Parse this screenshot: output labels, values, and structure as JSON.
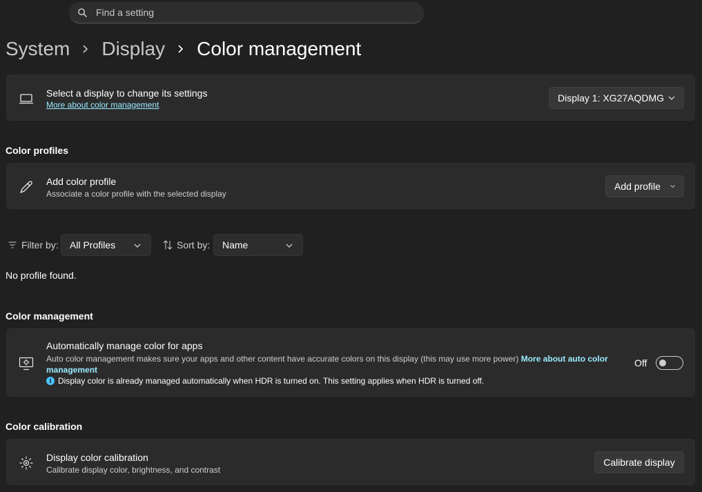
{
  "search": {
    "placeholder": "Find a setting"
  },
  "breadcrumb": {
    "items": [
      "System",
      "Display"
    ],
    "current": "Color management"
  },
  "display_select": {
    "title": "Select a display to change its settings",
    "link": "More about color management",
    "dropdown_value": "Display 1: XG27AQDMG"
  },
  "color_profiles": {
    "heading": "Color profiles",
    "add_title": "Add color profile",
    "add_sub": "Associate a color profile with the selected display",
    "add_button": "Add profile"
  },
  "filters": {
    "filter_label": "Filter by:",
    "filter_value": "All Profiles",
    "sort_label": "Sort by:",
    "sort_value": "Name",
    "empty_message": "No profile found."
  },
  "color_management": {
    "heading": "Color management",
    "auto_title": "Automatically manage color for apps",
    "auto_sub": "Auto color management makes sure your apps and other content have accurate colors on this display (this may use more power)",
    "auto_link": "More about auto color management",
    "info_icon": "i",
    "info_text": "Display color is already managed automatically when HDR is turned on. This setting applies when HDR is turned off.",
    "toggle_state": "Off"
  },
  "color_calibration": {
    "heading": "Color calibration",
    "title": "Display color calibration",
    "sub": "Calibrate display color, brightness, and contrast",
    "button": "Calibrate display"
  },
  "colors": {
    "background": "#202020",
    "card": "#2b2b2b",
    "link": "#99ebff",
    "accent": "#4cc2ff"
  },
  "icons": [
    "search-icon",
    "chevron-right-icon",
    "laptop-icon",
    "chevron-down-icon",
    "eyedropper-icon",
    "filter-icon",
    "sort-icon",
    "color-manage-icon",
    "info-icon",
    "brightness-icon"
  ]
}
